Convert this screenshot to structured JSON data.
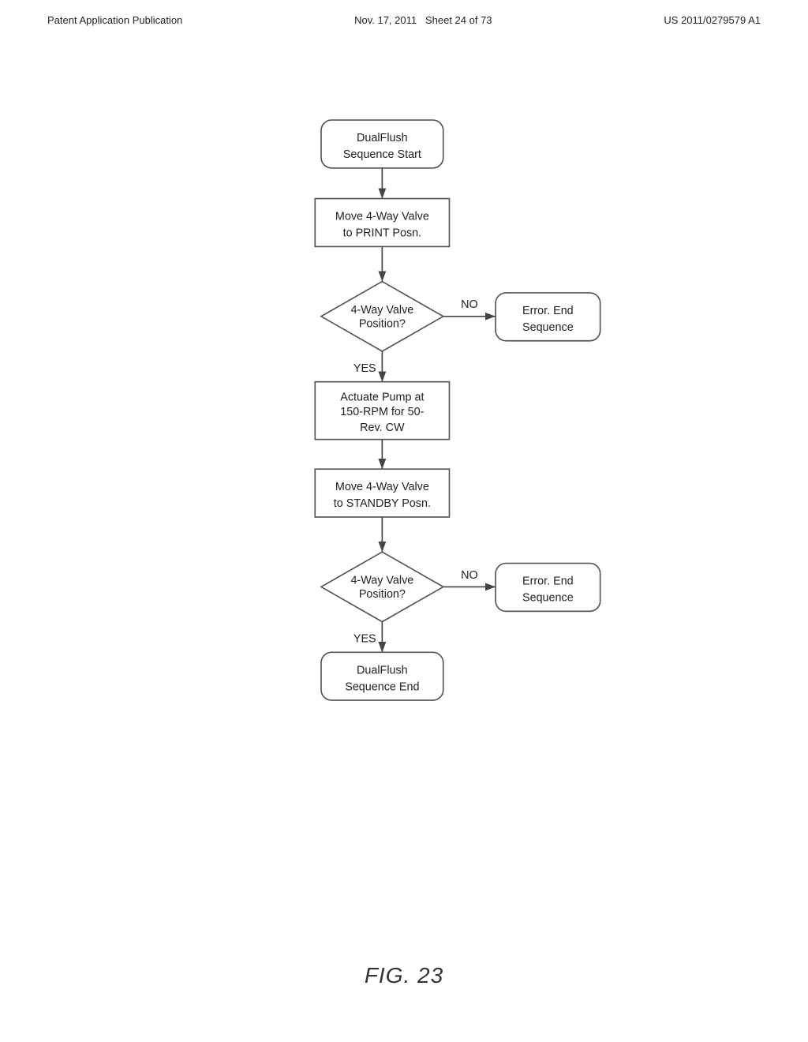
{
  "header": {
    "left": "Patent Application Publication",
    "center_date": "Nov. 17, 2011",
    "center_sheet": "Sheet 24 of 73",
    "right": "US 2011/0279579 A1"
  },
  "diagram": {
    "title": "FIG. 23",
    "nodes": [
      {
        "id": "start",
        "type": "rounded-rect",
        "label": [
          "DualFlush",
          "Sequence Start"
        ]
      },
      {
        "id": "step1",
        "type": "rect",
        "label": [
          "Move 4-Way Valve",
          "to PRINT Posn."
        ]
      },
      {
        "id": "dec1",
        "type": "diamond",
        "label": [
          "4-Way Valve",
          "Position?"
        ]
      },
      {
        "id": "err1",
        "type": "rounded-rect",
        "label": [
          "Error. End",
          "Sequence"
        ]
      },
      {
        "id": "step2",
        "type": "rect",
        "label": [
          "Actuate Pump at",
          "150-RPM for 50-",
          "Rev. CW"
        ]
      },
      {
        "id": "step3",
        "type": "rect",
        "label": [
          "Move 4-Way Valve",
          "to STANDBY Posn."
        ]
      },
      {
        "id": "dec2",
        "type": "diamond",
        "label": [
          "4-Way Valve",
          "Position?"
        ]
      },
      {
        "id": "err2",
        "type": "rounded-rect",
        "label": [
          "Error. End",
          "Sequence"
        ]
      },
      {
        "id": "end",
        "type": "rounded-rect",
        "label": [
          "DualFlush",
          "Sequence End"
        ]
      }
    ],
    "labels": {
      "no1": "NO",
      "yes1": "YES",
      "no2": "NO",
      "yes2": "YES"
    }
  }
}
